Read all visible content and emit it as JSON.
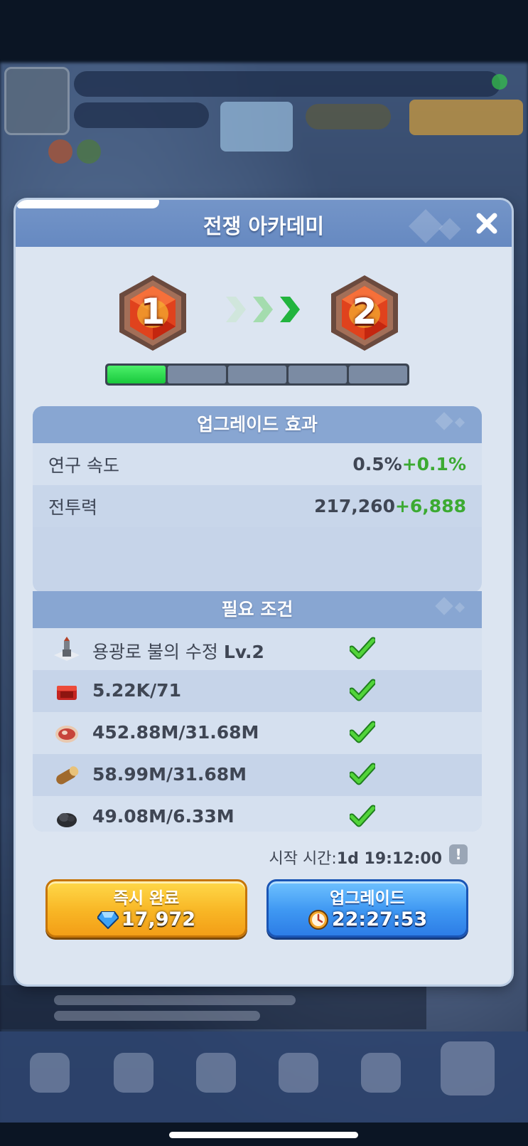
{
  "dialog": {
    "title": "전쟁 아카데미"
  },
  "levels": {
    "current": "1",
    "next": "2"
  },
  "progress": {
    "segments_total": 5,
    "segments_filled": 1
  },
  "effects": {
    "header": "업그레이드 효과",
    "rows": [
      {
        "label": "연구 속도",
        "value": "0.5%",
        "increase": "+0.1%"
      },
      {
        "label": "전투력",
        "value": "217,260",
        "increase": "+6,888"
      }
    ]
  },
  "requirements": {
    "header": "필요 조건",
    "rows": [
      {
        "icon": "building-icon",
        "prefix": "용광로  불의 수정 ",
        "text": "Lv.2",
        "met": true
      },
      {
        "icon": "fire-crystal-icon",
        "prefix": "",
        "text": "5.22K/71",
        "met": true
      },
      {
        "icon": "meat-icon",
        "prefix": "",
        "text": "452.88M/31.68M",
        "met": true
      },
      {
        "icon": "wood-icon",
        "prefix": "",
        "text": "58.99M/31.68M",
        "met": true
      },
      {
        "icon": "coal-icon",
        "prefix": "",
        "text": "49.08M/6.33M",
        "met": true
      }
    ]
  },
  "start_time": {
    "label": "시작 시간:",
    "value": "1d 19:12:00"
  },
  "buttons": {
    "instant": {
      "label": "즉시 완료",
      "cost": "17,972",
      "icon": "gem-icon"
    },
    "upgrade": {
      "label": "업그레이드",
      "time": "22:27:53",
      "icon": "clock-icon"
    }
  },
  "colors": {
    "header_blue": "#6f90c6",
    "increase_green": "#3caa32",
    "progress_green": "#22d044",
    "gold_button": "#f8b625",
    "blue_button": "#3e97f2"
  }
}
